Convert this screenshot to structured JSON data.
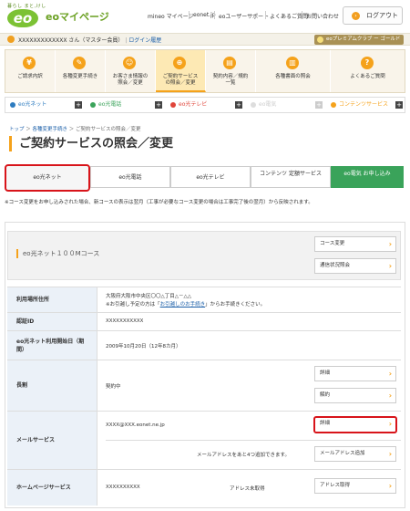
{
  "header": {
    "logo_tag": "暮らし まと,けし",
    "logo_mark": "eo",
    "title": "eoマイページ",
    "nav": [
      "mineo マイページ",
      "eonet.jp",
      "eoユーザーサポート",
      "よくあるご質問",
      "お問い合わせ"
    ],
    "logout_label": "ログアウト"
  },
  "userbar": {
    "user_text": "XXXXXXXXXXXXX さん（マスター会員）",
    "login_history": "ログイン履歴",
    "premium": "eoプレミアムクラブ ー ゴールド"
  },
  "main_nav": [
    {
      "icon": "¥",
      "label": "ご請求内訳"
    },
    {
      "icon": "✎",
      "label": "各種変更手続き"
    },
    {
      "icon": "☺",
      "label": "お客さま情報の照会／変更"
    },
    {
      "icon": "⊕",
      "label": "ご契約サービスの照会／変更"
    },
    {
      "icon": "▤",
      "label": "契約内容／規約一覧"
    },
    {
      "icon": "▥",
      "label": "各種書面の照会"
    },
    {
      "icon": "?",
      "label": "よくあるご質問"
    }
  ],
  "services": [
    {
      "label": "eo光ネット",
      "color": "#2e7cc0"
    },
    {
      "label": "eo光電話",
      "color": "#3aa35a"
    },
    {
      "label": "eo光テレビ",
      "color": "#e0453a"
    },
    {
      "label": "eo電気",
      "color": "#cccccc"
    },
    {
      "label": "コンテンツサービス",
      "color": "#f5a21b"
    }
  ],
  "breadcrumb": {
    "top": "トップ",
    "step": "各種変更手続き",
    "current": "ご契約サービスの照会／変更"
  },
  "page_title": "ご契約サービスの照会／変更",
  "tabs": [
    "eo光ネット",
    "eo光電話",
    "eo光テレビ",
    "コンテンツ 定額サービス",
    "eo電気 お申し込み"
  ],
  "note": "※コース変更をお申し込みされた場合、新コースの表示は翌月（工事が必要なコース変更の場合は工事完了後の翌月）から反映されます。",
  "plan": {
    "name": "eo光ネット１００Mコース",
    "course_change": "コース変更",
    "speed_check": "通信状況照会"
  },
  "details": {
    "address_label": "利用場所住所",
    "address_value": "大阪府大阪市中央区〇〇△丁目△－△△",
    "address_note_pre": "※お引越し予定の方は「",
    "address_note_link": "お引越しのお手続き",
    "address_note_post": "」からお手続きください。",
    "auth_label": "認証ID",
    "auth_value": "XXXXXXXXXXX",
    "start_label": "eo光ネット利用開始日（期間）",
    "start_value": "2009年10月20日（12年8カ月）",
    "discount_label": "長割",
    "discount_value": "契約中",
    "discount_detail": "詳細",
    "discount_cancel": "解約",
    "mail_label": "メールサービス",
    "mail_value": "XXXX@XXX.eonet.ne.jp",
    "mail_detail": "詳細",
    "mail_add_note": "メールアドレスをあと4つ追加できます。",
    "mail_add": "メールアドレス追加",
    "hp_label": "ホームページサービス",
    "hp_value": "XXXXXXXXXX",
    "hp_status": "アドレス未取得",
    "hp_get": "アドレス取得"
  }
}
